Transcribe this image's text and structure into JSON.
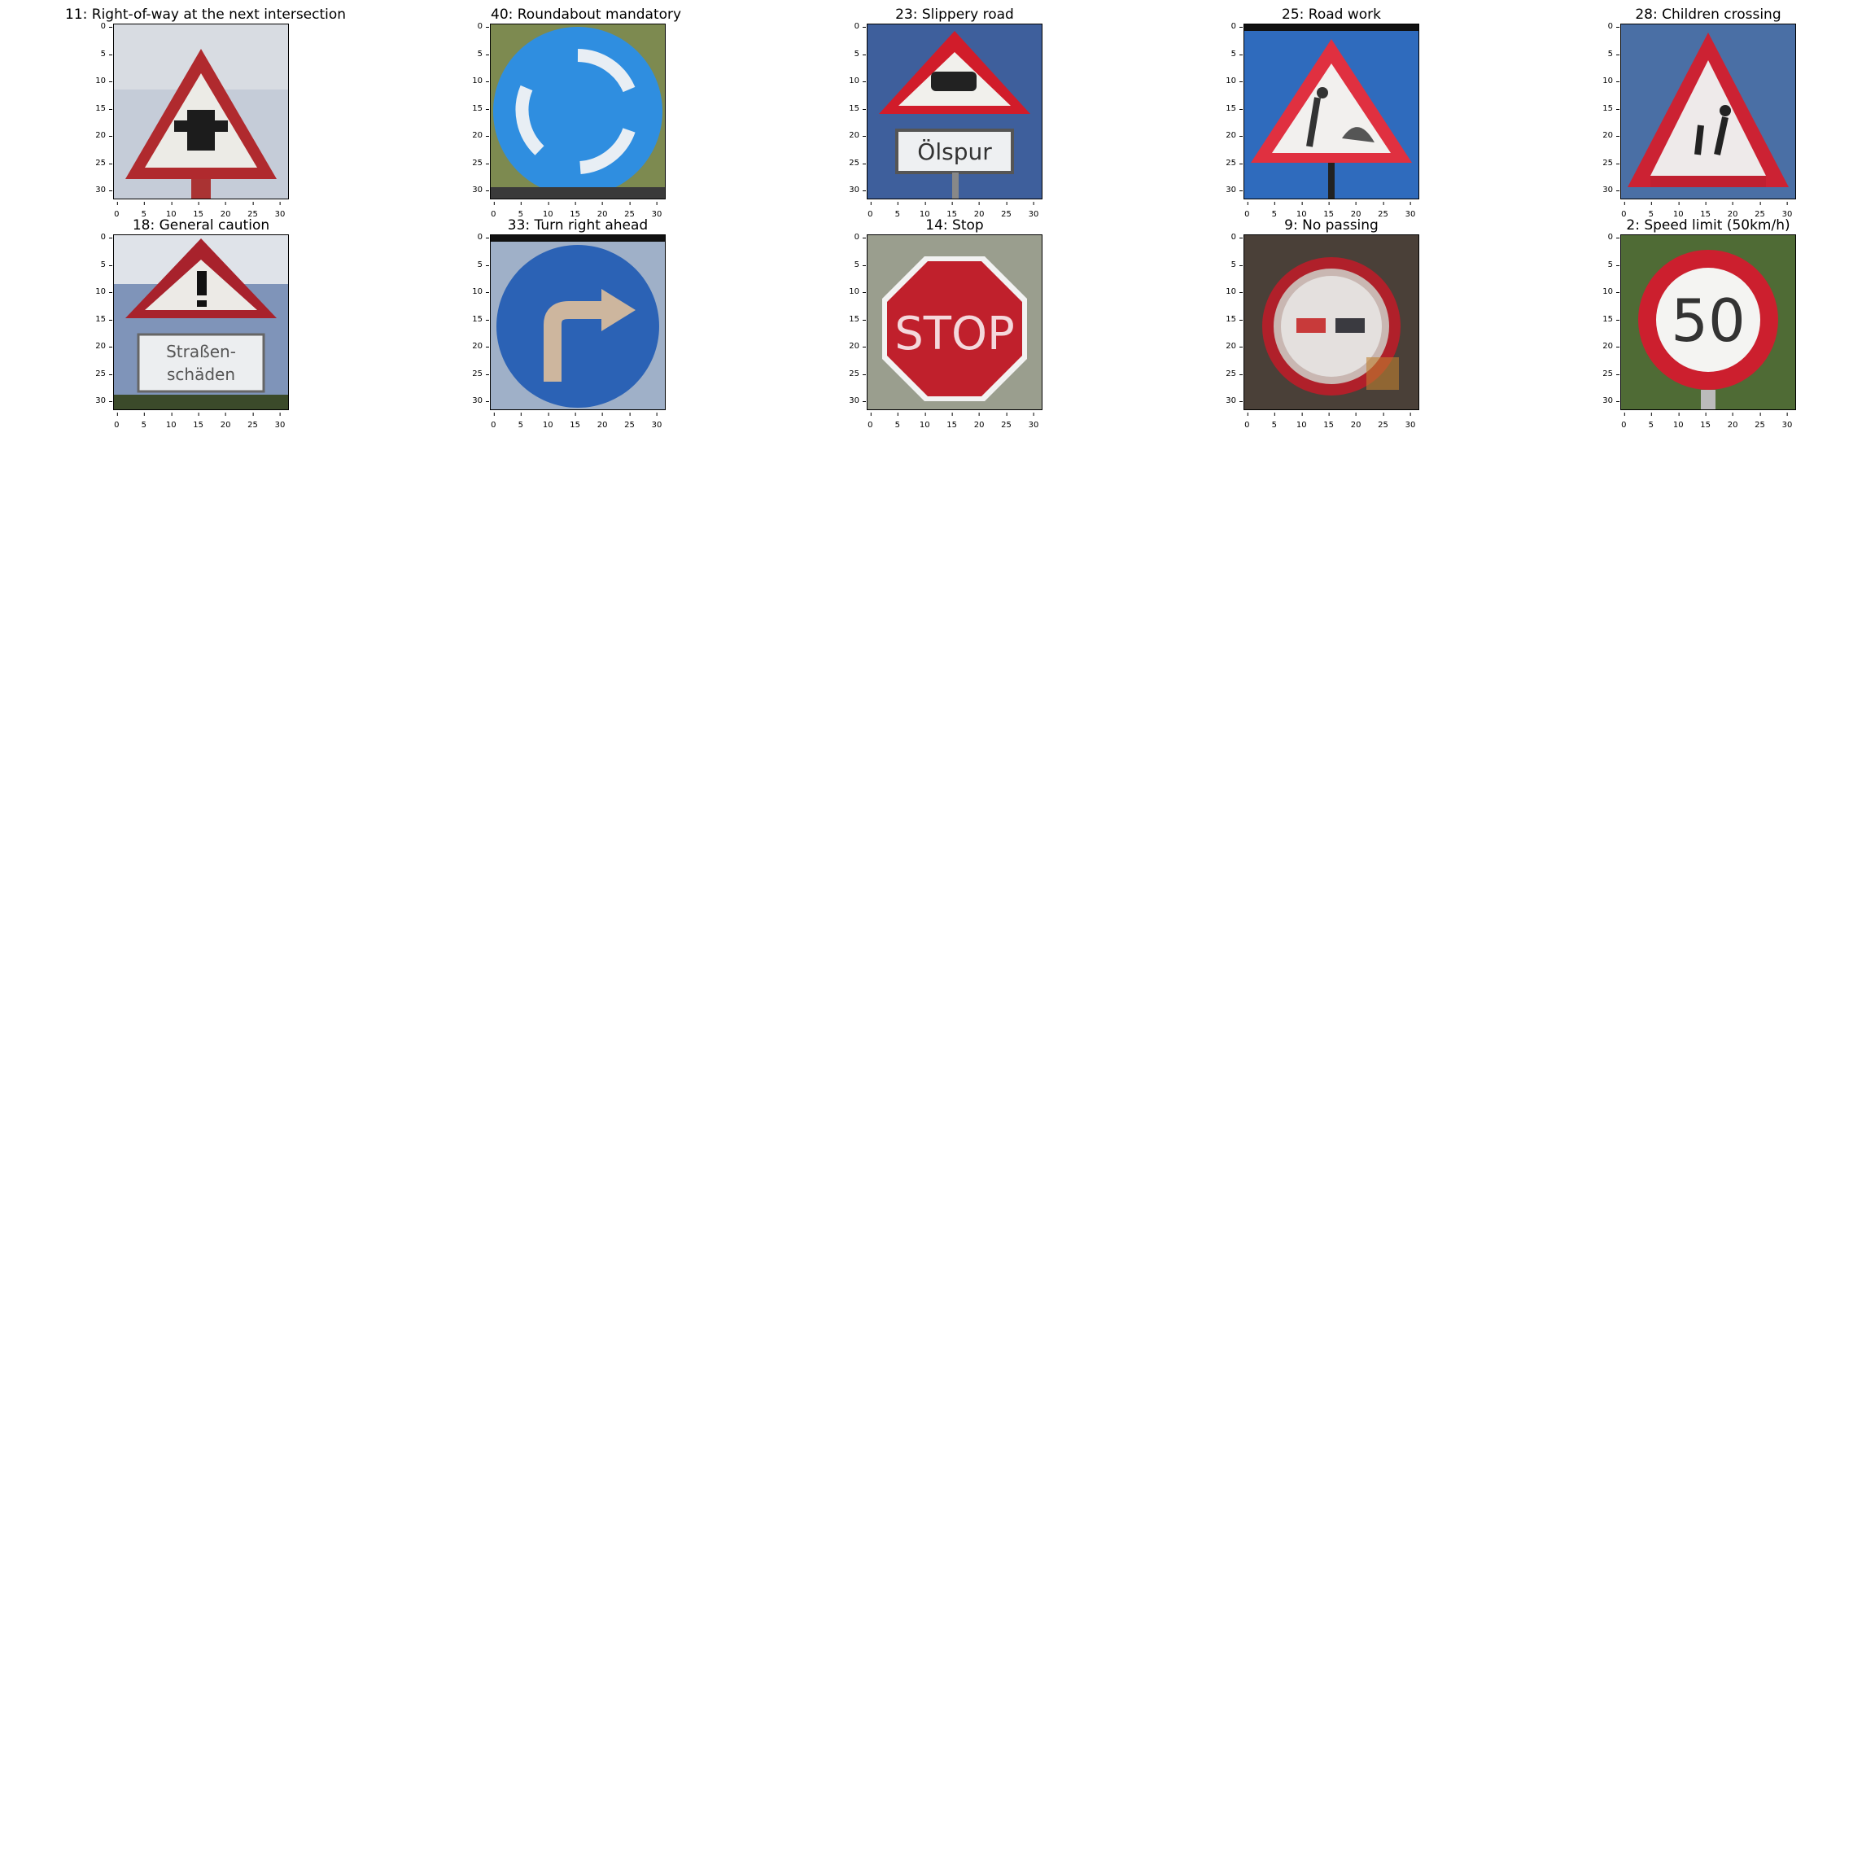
{
  "ticks": [
    "0",
    "5",
    "10",
    "15",
    "20",
    "25",
    "30"
  ],
  "panels": [
    {
      "title": "11: Right-of-way at the next intersection",
      "kind": "row11",
      "bg": "#c5ccd8"
    },
    {
      "title": "40: Roundabout mandatory",
      "kind": "round40",
      "bg": "#7d8a50"
    },
    {
      "title": "23: Slippery road",
      "kind": "slip23",
      "bg": "#3e5f9c",
      "sign_text": "Ölspur"
    },
    {
      "title": "25: Road work",
      "kind": "road25",
      "bg": "#2f6bbd"
    },
    {
      "title": "28: Children crossing",
      "kind": "child28",
      "bg": "#4a6fa5"
    },
    {
      "title": "18: General caution",
      "kind": "gen18",
      "bg": "#7f94b9",
      "sign_text_1": "Straßen-",
      "sign_text_2": "schäden"
    },
    {
      "title": "33: Turn right ahead",
      "kind": "turn33",
      "bg": "#9fb0c8"
    },
    {
      "title": "14: Stop",
      "kind": "stop14",
      "bg": "#9a9e8e",
      "sign_text": "STOP"
    },
    {
      "title": "9: No passing",
      "kind": "nopass9",
      "bg": "#4a4038"
    },
    {
      "title": "2: Speed limit (50km/h)",
      "kind": "speed2",
      "bg": "#4f6b35",
      "sign_text": "50"
    }
  ]
}
